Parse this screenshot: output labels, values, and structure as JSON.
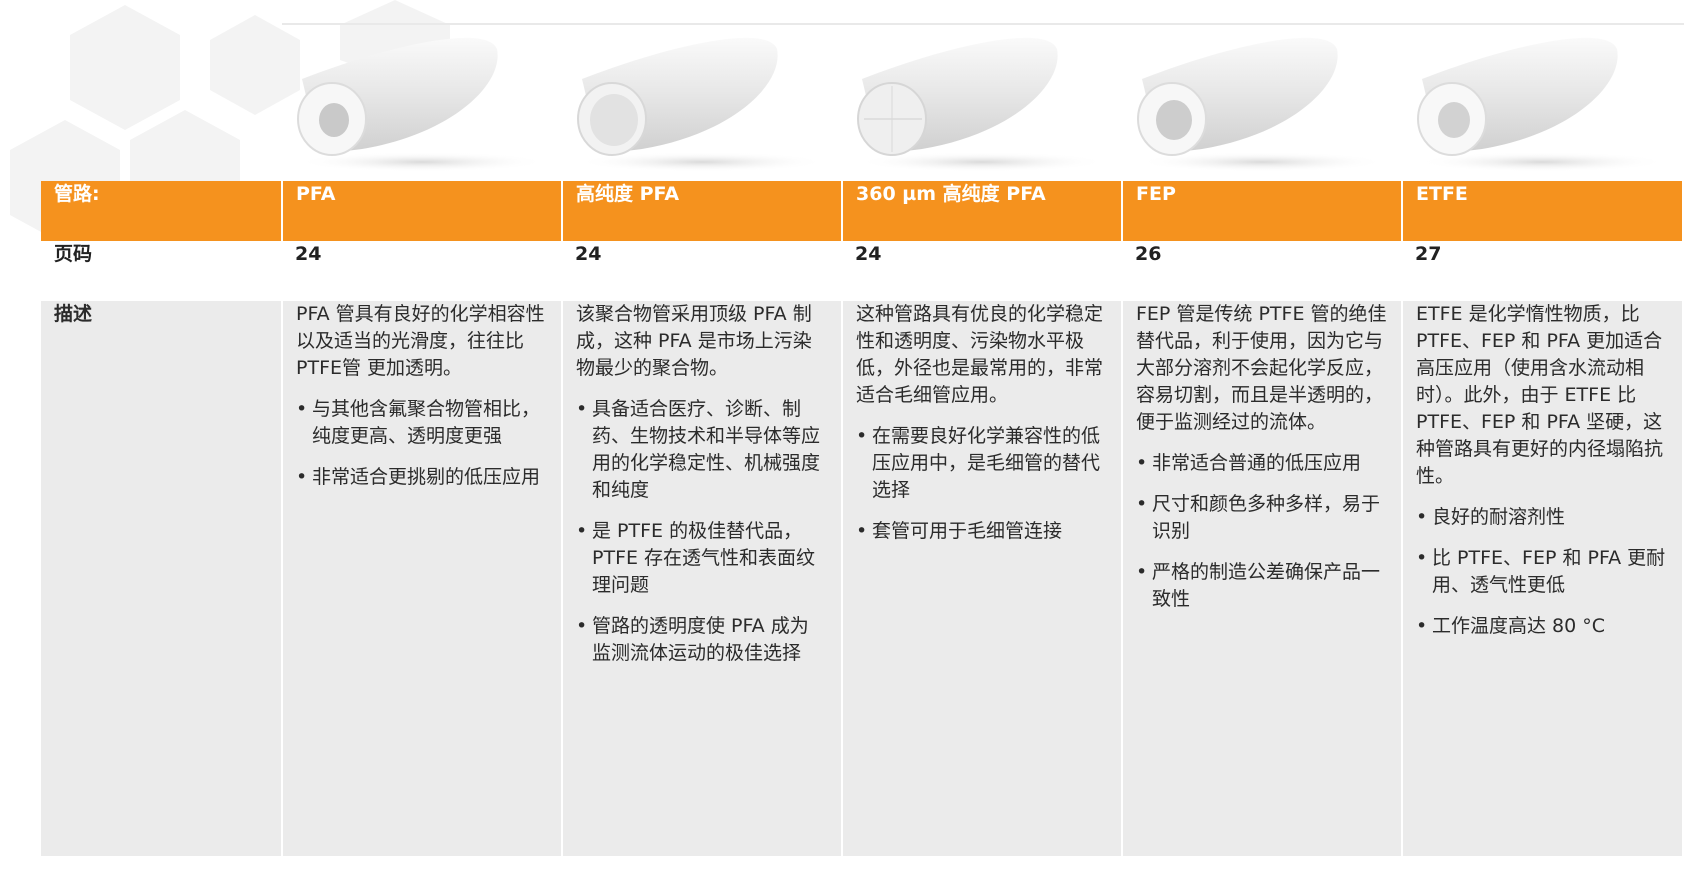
{
  "header": {
    "row_label": "管路:",
    "columns": [
      "PFA",
      "高纯度 PFA",
      "360 µm 高纯度 PFA",
      "FEP",
      "ETFE"
    ]
  },
  "page_row": {
    "label": "页码",
    "values": [
      "24",
      "24",
      "24",
      "26",
      "27"
    ]
  },
  "description_row": {
    "label": "描述",
    "cells": [
      {
        "intro": "PFA 管具有良好的化学相容性以及适当的光滑度，往往比 PTFE管 更加透明。",
        "bullets": [
          "与其他含氟聚合物管相比，纯度更高、透明度更强",
          "非常适合更挑剔的低压应用"
        ]
      },
      {
        "intro": "该聚合物管采用顶级 PFA 制成，这种 PFA 是市场上污染物最少的聚合物。",
        "bullets": [
          "具备适合医疗、诊断、制药、生物技术和半导体等应用的化学稳定性、机械强度和纯度",
          "是 PTFE 的极佳替代品，PTFE 存在透气性和表面纹理问题",
          "管路的透明度使 PFA 成为监测流体运动的极佳选择"
        ]
      },
      {
        "intro": "这种管路具有优良的化学稳定性和透明度、污染物水平极低，外径也是最常用的，非常适合毛细管应用。",
        "bullets": [
          "在需要良好化学兼容性的低压应用中，是毛细管的替代选择",
          "套管可用于毛细管连接"
        ]
      },
      {
        "intro": "FEP 管是传统 PTFE 管的绝佳替代品，利于使用，因为它与大部分溶剂不会起化学反应，容易切割，而且是半透明的，便于监测经过的流体。",
        "bullets": [
          "非常适合普通的低压应用",
          "尺寸和颜色多种多样，易于识别",
          "严格的制造公差确保产品一致性"
        ]
      },
      {
        "intro": "ETFE 是化学惰性物质，比 PTFE、FEP 和 PFA 更加适合高压应用（使用含水流动相时）。此外，由于 ETFE 比 PTFE、FEP 和 PFA 坚硬，这种管路具有更好的内径塌陷抗性。",
        "bullets": [
          "良好的耐溶剂性",
          "比 PTFE、FEP 和 PFA 更耐用、透气性更低",
          "工作温度高达 80 °C"
        ]
      }
    ]
  },
  "images": [
    "pfa-tube-image",
    "high-purity-pfa-tube-image",
    "360um-pfa-tube-image",
    "fep-tube-image",
    "etfe-tube-image"
  ],
  "colors": {
    "header_orange": "#f5921e",
    "row_gray": "#ebebeb",
    "hex_pattern": "#f4f4f4"
  }
}
